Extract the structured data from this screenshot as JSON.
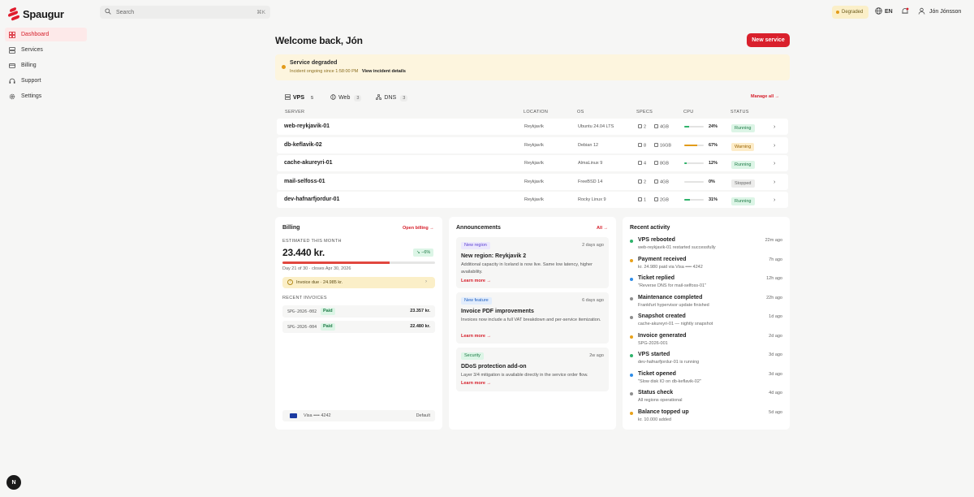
{
  "app": {
    "name": "Spaugur"
  },
  "sidebar": {
    "items": [
      {
        "label": "Dashboard",
        "icon": "grid-icon",
        "active": true
      },
      {
        "label": "Services",
        "icon": "server-icon"
      },
      {
        "label": "Billing",
        "icon": "card-icon"
      },
      {
        "label": "Support",
        "icon": "headset-icon"
      },
      {
        "label": "Settings",
        "icon": "gear-icon"
      }
    ],
    "help_label": "N"
  },
  "topbar": {
    "search_placeholder": "Search",
    "search_shortcut": "⌘K",
    "status_label": "Degraded",
    "language": "EN",
    "user_name": "Jón Jónsson"
  },
  "main": {
    "welcome": "Welcome back, Jón",
    "new_service_label": "New service",
    "banner": {
      "title": "Service degraded",
      "subtitle": "Incident ongoing since 1:58:00 PM",
      "link": "View incident details"
    },
    "tabs": [
      {
        "label": "VPS",
        "count": "5",
        "icon": "server-icon"
      },
      {
        "label": "Web",
        "count": "3",
        "icon": "globe-icon"
      },
      {
        "label": "DNS",
        "count": "3",
        "icon": "network-icon"
      }
    ],
    "manage_all": "Manage all →",
    "table": {
      "headers": [
        "SERVER",
        "LOCATION",
        "OS",
        "SPECS",
        "CPU",
        "STATUS"
      ],
      "rows": [
        {
          "server": "web-reykjavik-01",
          "location": "Reykjavík",
          "os": "Ubuntu 24.04 LTS",
          "cores": "2",
          "ram": "4GB",
          "cpu": "24%",
          "cpu_level": 24,
          "status": "Running"
        },
        {
          "server": "db-keflavik-02",
          "location": "Reykjavík",
          "os": "Debian 12",
          "cores": "8",
          "ram": "16GB",
          "cpu": "67%",
          "cpu_level": 67,
          "status": "Warning"
        },
        {
          "server": "cache-akureyri-01",
          "location": "Reykjavík",
          "os": "AlmaLinux 9",
          "cores": "4",
          "ram": "8GB",
          "cpu": "12%",
          "cpu_level": 12,
          "status": "Running"
        },
        {
          "server": "mail-selfoss-01",
          "location": "Reykjavík",
          "os": "FreeBSD 14",
          "cores": "2",
          "ram": "4GB",
          "cpu": "0%",
          "cpu_level": 0,
          "status": "Stopped"
        },
        {
          "server": "dev-hafnarfjordur-01",
          "location": "Reykjavík",
          "os": "Rocky Linux 9",
          "cores": "1",
          "ram": "2GB",
          "cpu": "31%",
          "cpu_level": 31,
          "status": "Running"
        }
      ]
    }
  },
  "billing": {
    "title": "Billing",
    "link": "Open billing →",
    "label": "ESTIMATED THIS MONTH",
    "amount": "23.440 kr.",
    "change": "↘ −6%",
    "progress": 0.7,
    "days": "Day 21 of 30 · closes Apr 30, 2026",
    "invoice_due": "Invoice due · 24.985 kr.",
    "recent_label": "RECENT INVOICES",
    "invoices": [
      {
        "id": "SPG-2026-002",
        "status": "Paid",
        "amount": "23.357 kr."
      },
      {
        "id": "SPG-2026-004",
        "status": "Paid",
        "amount": "22.480 kr."
      }
    ],
    "card_label": "Visa •••• 4242",
    "card_default": "Default"
  },
  "announcements": {
    "title": "Announcements",
    "link": "All →",
    "items": [
      {
        "tag": "New region",
        "date": "2 days ago",
        "title": "New region: Reykjavik 2",
        "body": "Additional capacity in Iceland is now live. Same low latency, higher availability.",
        "more": "Learn more →"
      },
      {
        "tag": "New feature",
        "date": "6 days ago",
        "title": "Invoice PDF improvements",
        "body": "Invoices now include a full VAT breakdown and per-service itemization.",
        "more": "Learn more →"
      },
      {
        "tag": "Security",
        "date": "2w ago",
        "title": "DDoS protection add-on",
        "body": "Layer 3/4 mitigation is available directly in the service order flow.",
        "more": "Learn more →"
      }
    ]
  },
  "activity": {
    "title": "Recent activity",
    "items": [
      {
        "title": "VPS rebooted",
        "sub": "web-reykjavik-01 restarted successfully",
        "time": "22m ago",
        "color": "#2fb36b"
      },
      {
        "title": "Payment received",
        "sub": "kr. 24.980 paid via Visa •••• 4242",
        "time": "7h ago",
        "color": "#e8a21b"
      },
      {
        "title": "Ticket replied",
        "sub": "\"Reverse DNS for mail-selfoss-01\"",
        "time": "12h ago",
        "color": "#2f8de8"
      },
      {
        "title": "Maintenance completed",
        "sub": "Frankfurt hypervisor update finished",
        "time": "22h ago",
        "color": "#8e8e8e"
      },
      {
        "title": "Snapshot created",
        "sub": "cache-akureyri-01 — nightly snapshot",
        "time": "1d ago",
        "color": "#8e8e8e"
      },
      {
        "title": "Invoice generated",
        "sub": "SPG-2026-001",
        "time": "2d ago",
        "color": "#e8a21b"
      },
      {
        "title": "VPS started",
        "sub": "dev-hafnarfjordur-01 is running",
        "time": "3d ago",
        "color": "#2fb36b"
      },
      {
        "title": "Ticket opened",
        "sub": "\"Slow disk IO on db-keflavik-02\"",
        "time": "3d ago",
        "color": "#2f8de8"
      },
      {
        "title": "Status check",
        "sub": "All regions operational",
        "time": "4d ago",
        "color": "#8e8e8e"
      },
      {
        "title": "Balance topped up",
        "sub": "kr. 10.000 added",
        "time": "5d ago",
        "color": "#e8a21b"
      }
    ]
  },
  "colors": {
    "accent": "#d9202c",
    "running": "#2fb36b",
    "warning": "#e29b1a",
    "stopped": "#9a9a9a"
  }
}
